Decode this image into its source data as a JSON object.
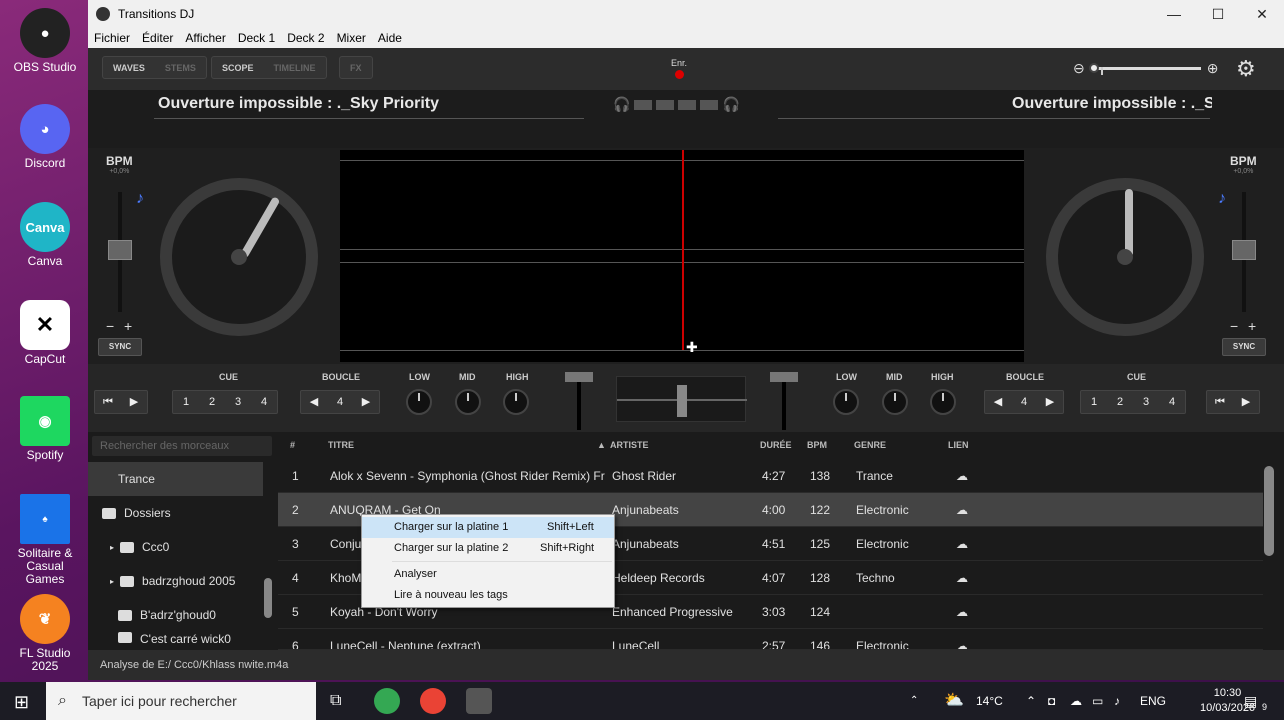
{
  "desktop": {
    "icons": [
      {
        "label": "OBS Studio",
        "color": "#222"
      },
      {
        "label": "Discord",
        "color": "#5865f2"
      },
      {
        "label": "Canva",
        "color": "#1fb5c7"
      },
      {
        "label": "CapCut",
        "color": "#fff"
      },
      {
        "label": "Spotify",
        "color": "#1ed760"
      },
      {
        "label": "Solitaire & Casual Games",
        "color": "#1a73e8"
      },
      {
        "label": "FL Studio 2025",
        "color": "#f58220"
      }
    ]
  },
  "window": {
    "title": "Transitions DJ",
    "controls": {
      "minimize": "—",
      "maximize": "☐",
      "close": "✕"
    },
    "menu": [
      "Fichier",
      "Éditer",
      "Afficher",
      "Deck 1",
      "Deck 2",
      "Mixer",
      "Aide"
    ]
  },
  "toolbar": {
    "waves": "WAVES",
    "stems": "STEMS",
    "scope": "SCOPE",
    "timeline": "TIMELINE",
    "fx": "FX",
    "rec_label": "Enr.",
    "zoom_out": "⊖",
    "zoom_in": "⊕",
    "zoom_level": 0.0,
    "settings_icon": "gear-icon"
  },
  "decks": {
    "left": {
      "title": "Ouverture impossible : ._Sky Priority",
      "bpm_label": "BPM",
      "pitch": "+0,0%",
      "minus": "−",
      "plus": "+",
      "sync": "SYNC"
    },
    "right": {
      "title": "Ouverture impossible : ._Se",
      "bpm_label": "BPM",
      "pitch": "+0,0%",
      "minus": "−",
      "plus": "+",
      "sync": "SYNC"
    }
  },
  "controls": {
    "cue_label": "CUE",
    "loop_label": "BOUCLE",
    "low": "LOW",
    "mid": "MID",
    "high": "HIGH",
    "cue_buttons": [
      "1",
      "2",
      "3",
      "4"
    ],
    "loop_value": "4",
    "prev": "◀",
    "next": "▶",
    "skip_back": "⏮",
    "play": "▶"
  },
  "library": {
    "search_placeholder": "Rechercher des morceaux",
    "sidebar": [
      {
        "label": "Trance"
      },
      {
        "label": "Dossiers"
      },
      {
        "label": "Ccc0"
      },
      {
        "label": "badrzghoud 2005"
      },
      {
        "label": "B'adrz'ghoud0"
      },
      {
        "label": "C'est carré wick0"
      }
    ],
    "columns": {
      "num": "#",
      "title": "TITRE",
      "artist": "ARTISTE",
      "duration": "DURÉE",
      "bpm": "BPM",
      "genre": "GENRE",
      "link": "LIEN"
    },
    "rows": [
      {
        "num": "1",
        "title": "Alok x Sevenn - Symphonia (Ghost Rider Remix) Fr",
        "artist": "Ghost Rider",
        "duration": "4:27",
        "bpm": "138",
        "genre": "Trance",
        "link": "☁"
      },
      {
        "num": "2",
        "title": "ANUQRAM - Get On",
        "artist": "Anjunabeats",
        "duration": "4:00",
        "bpm": "122",
        "genre": "Electronic",
        "link": "☁"
      },
      {
        "num": "3",
        "title": "Conju",
        "artist": "Anjunabeats",
        "duration": "4:51",
        "bpm": "125",
        "genre": "Electronic",
        "link": "☁"
      },
      {
        "num": "4",
        "title": "KhoM",
        "artist": "Heldeep Records",
        "duration": "4:07",
        "bpm": "128",
        "genre": "Techno",
        "link": "☁"
      },
      {
        "num": "5",
        "title": "Koyah - Don't Worry",
        "artist": "Enhanced Progressive",
        "duration": "3:03",
        "bpm": "124",
        "genre": "",
        "link": "☁"
      },
      {
        "num": "6",
        "title": "LuneCell - Neptune (extract)",
        "artist": "LuneCell",
        "duration": "2:57",
        "bpm": "146",
        "genre": "Electronic",
        "link": "☁"
      }
    ]
  },
  "context_menu": {
    "items": [
      {
        "label": "Charger sur la platine 1",
        "shortcut": "Shift+Left"
      },
      {
        "label": "Charger sur la platine 2",
        "shortcut": "Shift+Right"
      },
      {
        "label": "Analyser",
        "shortcut": ""
      },
      {
        "label": "Lire à nouveau les tags",
        "shortcut": ""
      }
    ]
  },
  "status": {
    "text": "Analyse de E:/ Ccc0/Khlass nwite.m4a"
  },
  "taskbar": {
    "search_placeholder": "Taper ici pour rechercher",
    "weather": "14°C",
    "lang": "ENG",
    "time": "10:30",
    "date": "10/03/2026",
    "notif_count": "9"
  }
}
